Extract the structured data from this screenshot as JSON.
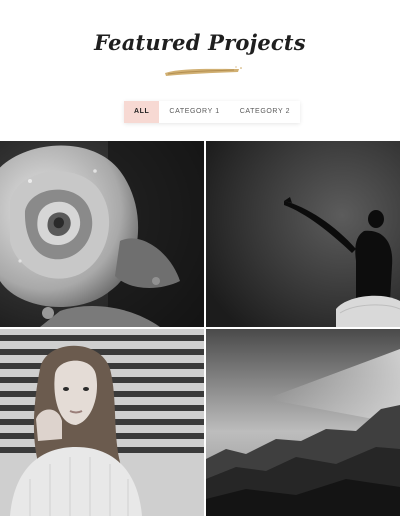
{
  "section": {
    "title": "Featured Projects",
    "accent_color": "#f7d9d3",
    "brush_color": "#c9a25a"
  },
  "filters": [
    {
      "label": "ALL",
      "active": true
    },
    {
      "label": "CATEGORY 1",
      "active": false
    },
    {
      "label": "CATEGORY 2",
      "active": false
    }
  ],
  "projects": [
    {
      "image": "rose-photo"
    },
    {
      "image": "ballet-dancer-photo"
    },
    {
      "image": "woman-portrait-photo"
    },
    {
      "image": "mountain-landscape-photo"
    }
  ]
}
